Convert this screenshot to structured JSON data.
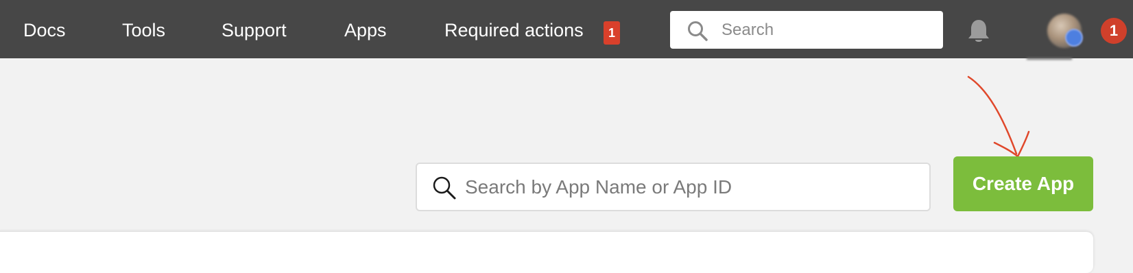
{
  "nav": {
    "items": [
      {
        "label": "Docs"
      },
      {
        "label": "Tools"
      },
      {
        "label": "Support"
      },
      {
        "label": "Apps"
      },
      {
        "label": "Required actions",
        "badge": "1"
      }
    ],
    "search_placeholder": "Search",
    "notification_count": "1"
  },
  "main": {
    "search_placeholder": "Search by App Name or App ID",
    "create_button_label": "Create App"
  },
  "colors": {
    "topbar": "#474747",
    "badge": "#d9402b",
    "create_button": "#7cbd3c",
    "annotation_arrow": "#e0482b"
  }
}
